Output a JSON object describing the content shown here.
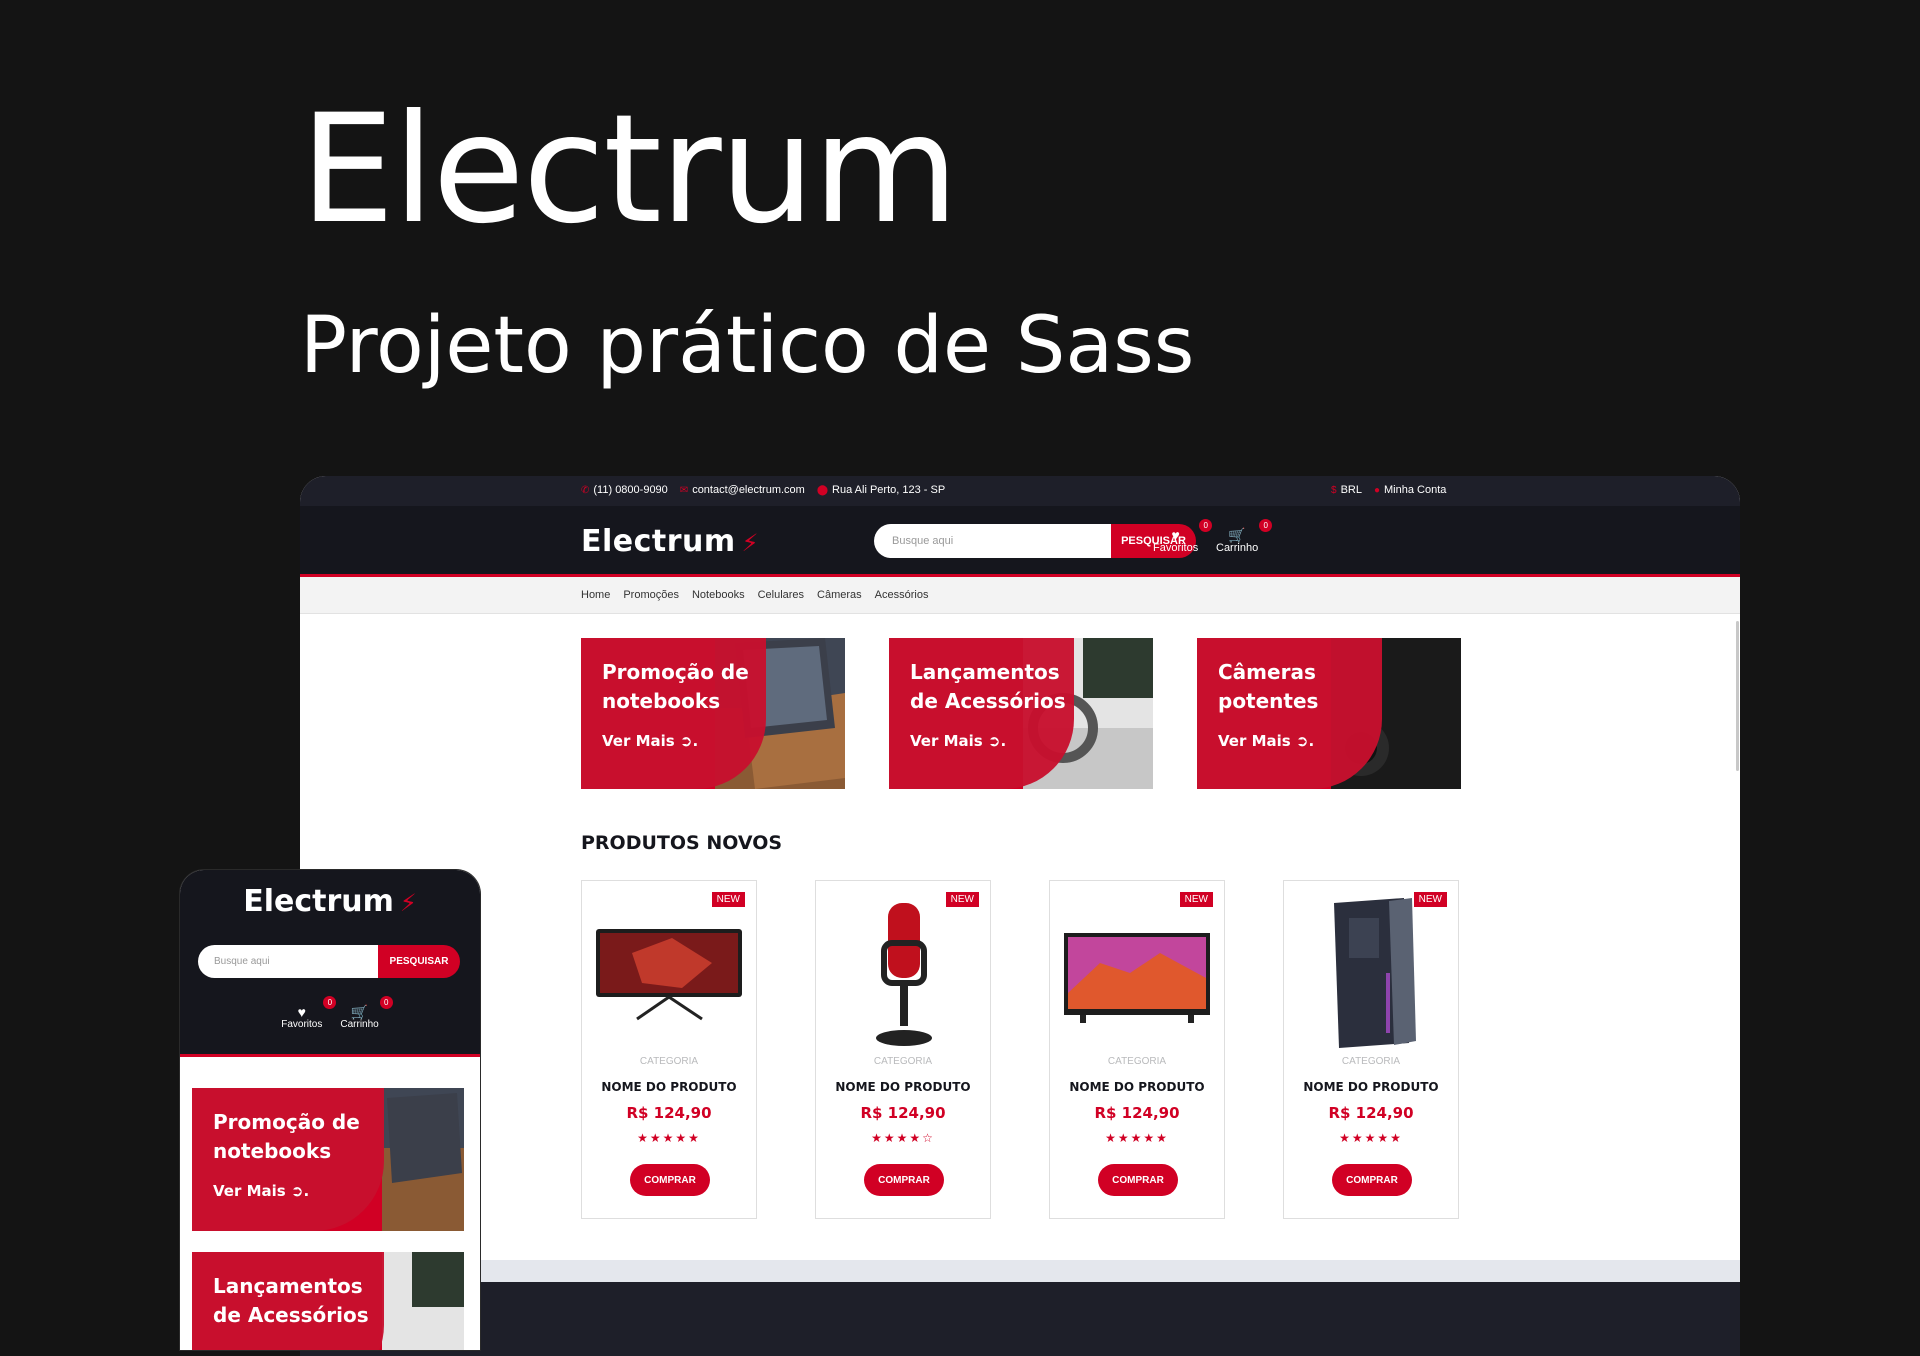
{
  "hero": {
    "title": "Electrum",
    "subtitle": "Projeto prático de Sass"
  },
  "topbar": {
    "phone": "(11) 0800-9090",
    "email": "contact@electrum.com",
    "address": "Rua Ali Perto, 123 - SP",
    "currency": "BRL",
    "account": "Minha Conta"
  },
  "header": {
    "logo": "Electrum",
    "search_placeholder": "Busque aqui",
    "search_button": "PESQUISAR",
    "favorites_label": "Favoritos",
    "favorites_count": "0",
    "cart_label": "Carrinho",
    "cart_count": "0"
  },
  "nav": {
    "items": [
      "Home",
      "Promoções",
      "Notebooks",
      "Celulares",
      "Câmeras",
      "Acessórios"
    ]
  },
  "banners": [
    {
      "title": "Promoção de notebooks",
      "link": "Ver Mais ➲."
    },
    {
      "title": "Lançamentos de Acessórios",
      "link": "Ver Mais ➲."
    },
    {
      "title": "Câmeras potentes",
      "link": "Ver Mais ➲."
    }
  ],
  "products_section": {
    "title": "PRODUTOS NOVOS",
    "items": [
      {
        "tag": "NEW",
        "category": "CATEGORIA",
        "name": "NOME DO PRODUTO",
        "price": "R$ 124,90",
        "rating": "★★★★★",
        "rating_value": 5,
        "button": "COMPRAR",
        "image": "monitor"
      },
      {
        "tag": "NEW",
        "category": "CATEGORIA",
        "name": "NOME DO PRODUTO",
        "price": "R$ 124,90",
        "rating": "★★★★☆",
        "rating_value": 4,
        "button": "COMPRAR",
        "image": "microphone"
      },
      {
        "tag": "NEW",
        "category": "CATEGORIA",
        "name": "NOME DO PRODUTO",
        "price": "R$ 124,90",
        "rating": "★★★★★",
        "rating_value": 5,
        "button": "COMPRAR",
        "image": "tv"
      },
      {
        "tag": "NEW",
        "category": "CATEGORIA",
        "name": "NOME DO PRODUTO",
        "price": "R$ 124,90",
        "rating": "★★★★★",
        "rating_value": 5,
        "button": "COMPRAR",
        "image": "pc-case"
      }
    ]
  },
  "mobile": {
    "logo": "Electrum",
    "search_placeholder": "Busque aqui",
    "search_button": "PESQUISAR",
    "favorites_label": "Favoritos",
    "favorites_count": "0",
    "cart_label": "Carrinho",
    "cart_count": "0",
    "banners": [
      {
        "title": "Promoção de notebooks",
        "link": "Ver Mais ➲."
      },
      {
        "title": "Lançamentos de Acessórios"
      }
    ]
  },
  "colors": {
    "accent": "#d10024",
    "dark": "#15161d",
    "page_bg": "#141414"
  },
  "icons": {
    "phone": "phone-icon",
    "email": "envelope-icon",
    "address": "map-pin-icon",
    "currency": "dollar-icon",
    "account": "user-icon",
    "favorites": "heart-icon",
    "cart": "cart-icon",
    "logo_mark": "lightning-bolt-icon"
  }
}
